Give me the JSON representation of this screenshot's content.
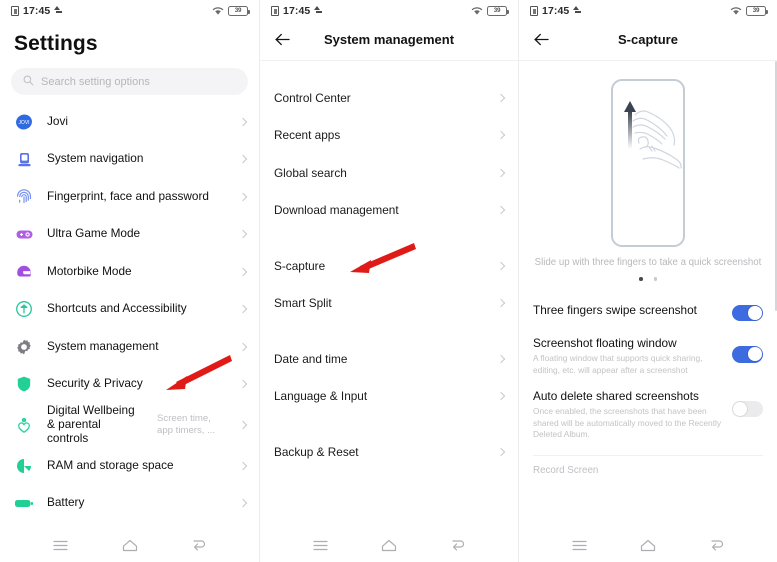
{
  "status_bar": {
    "time": "17:45",
    "battery_text": "39",
    "sim_icon": "sim-card-icon",
    "upload_icon": "upload-arrow-icon",
    "wifi_icon": "wifi-icon",
    "battery_icon": "battery-icon"
  },
  "colors": {
    "accent_toggle_on": "#3D6BE0",
    "toggle_off": "#ebebed",
    "arrow_red": "#E01B17",
    "title_black": "#101010",
    "muted_grey": "#bfbfc4"
  },
  "panel_settings": {
    "title": "Settings",
    "search": {
      "placeholder": "Search setting options",
      "value": ""
    },
    "items": [
      {
        "label": "Jovi",
        "icon": "jovi-icon",
        "sub": ""
      },
      {
        "label": "System navigation",
        "icon": "system-navigation-icon",
        "sub": ""
      },
      {
        "label": "Fingerprint, face and password",
        "icon": "fingerprint-icon",
        "sub": ""
      },
      {
        "label": "Ultra Game Mode",
        "icon": "game-mode-icon",
        "sub": ""
      },
      {
        "label": "Motorbike Mode",
        "icon": "motorbike-helmet-icon",
        "sub": ""
      },
      {
        "label": "Shortcuts and Accessibility",
        "icon": "accessibility-icon",
        "sub": ""
      },
      {
        "label": "System management",
        "icon": "gear-icon",
        "sub": ""
      },
      {
        "label": "Security & Privacy",
        "icon": "shield-icon",
        "sub": ""
      },
      {
        "label": "Digital Wellbeing & parental controls",
        "icon": "wellbeing-icon",
        "sub": "Screen time, app timers, ..."
      },
      {
        "label": "RAM and storage space",
        "icon": "storage-pie-icon",
        "sub": ""
      },
      {
        "label": "Battery",
        "icon": "battery-solid-icon",
        "sub": ""
      }
    ]
  },
  "panel_system_management": {
    "title": "System management",
    "back_icon": "back-arrow-icon",
    "groups": [
      {
        "items": [
          "Control Center",
          "Recent apps",
          "Global search",
          "Download management"
        ]
      },
      {
        "items": [
          "S-capture",
          "Smart Split"
        ]
      },
      {
        "items": [
          "Date and time",
          "Language & Input"
        ]
      },
      {
        "items": [
          "Backup & Reset"
        ]
      }
    ]
  },
  "panel_scapture": {
    "title": "S-capture",
    "back_icon": "back-arrow-icon",
    "illustration": {
      "name": "three-finger-swipe-illustration",
      "hint": "Slide up with three fingers to take a quick screenshot"
    },
    "pager": {
      "count": 2,
      "active_index": 0
    },
    "settings": [
      {
        "label": "Three fingers swipe screenshot",
        "desc": "",
        "toggle": "on"
      },
      {
        "label": "Screenshot floating window",
        "desc": "A floating window that supports quick sharing, editing, etc. will appear after a screenshot",
        "toggle": "on"
      },
      {
        "label": "Auto delete shared screenshots",
        "desc": "Once enabled, the screenshots that have been shared will be automatically moved to the Recently Deleted Album.",
        "toggle": "off"
      }
    ],
    "section_label": "Record Screen"
  },
  "nav_bar": {
    "menu_label": "menu-icon",
    "home_label": "home-icon",
    "back_label": "back-icon"
  },
  "annotations": [
    {
      "name": "arrow-security-privacy",
      "target": "Security & Privacy"
    },
    {
      "name": "arrow-s-capture",
      "target": "S-capture"
    },
    {
      "name": "arrow-three-fingers-toggle",
      "target": "Three fingers swipe screenshot"
    }
  ]
}
